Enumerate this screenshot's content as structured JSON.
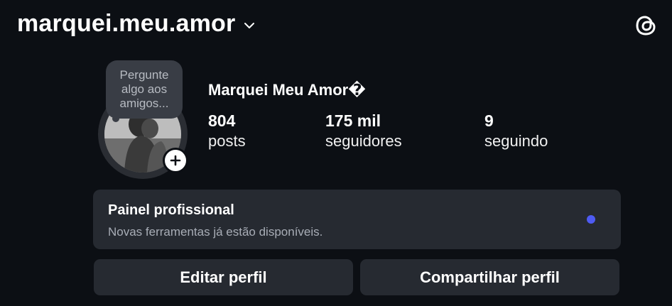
{
  "header": {
    "username": "marquei.meu.amor",
    "chevron_icon": "chevron-down-icon",
    "threads_icon": "threads-icon"
  },
  "profile": {
    "note_placeholder": "Pergunte algo aos amigos...",
    "full_name": "Marquei Meu Amor�",
    "avatar_badge_icon": "plus-icon",
    "stats": [
      {
        "value": "804",
        "label": "posts"
      },
      {
        "value": "175 mil",
        "label": "seguidores"
      },
      {
        "value": "9",
        "label": "seguindo"
      }
    ]
  },
  "panel": {
    "title": "Painel profissional",
    "subtitle": "Novas ferramentas já estão disponíveis.",
    "dot_color": "#4e5bf2"
  },
  "buttons": {
    "edit": "Editar perfil",
    "share": "Compartilhar perfil"
  },
  "colors": {
    "background": "#0c0f14",
    "card": "#262a31",
    "accent": "#4e5bf2"
  }
}
